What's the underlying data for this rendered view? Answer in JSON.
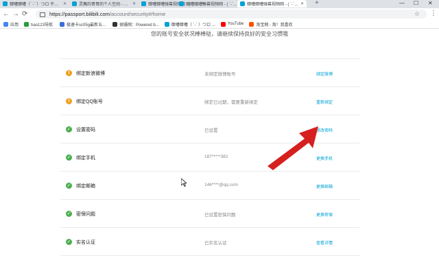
{
  "browser": {
    "tabs": [
      {
        "label": "肆嘈肆嘈（ ´-` ）つロ 干杯~-bili",
        "active": false
      },
      {
        "label": "灵舞的哥哥的个人空间 - 肆嘈肆",
        "active": false
      },
      {
        "label": "肆嘈肆嘈弹幕视频网 - ( ´-` )つロ",
        "active": false
      },
      {
        "label": "肆嘈肆嘈弹幕视频网 - ( ´-` )つロ",
        "active": false
      },
      {
        "label": "肆嘈肆嘈弹幕视频网 - ( ´-` )つロ",
        "active": true
      }
    ],
    "new_tab": "+",
    "window_controls": [
      "—",
      "☐",
      "✕"
    ],
    "url_host": "https://passport.bilibili.com",
    "url_path": "/account/security#/home",
    "bookmarks": [
      {
        "label": "应用",
        "color": "#4285f4"
      },
      {
        "label": "hao123导航",
        "color": "#2a9d3a"
      },
      {
        "label": "极速卡sc05g最新五...",
        "color": "#3a6fd8"
      },
      {
        "label": "很骚网：Powered b...",
        "color": "#333333"
      },
      {
        "label": "肆嘈肆嘈（ ´-` ）つロ ...",
        "color": "#00a1d6"
      },
      {
        "label": "YouTube",
        "color": "#ff0000"
      },
      {
        "label": "淘宝网 - 淘！我喜欢",
        "color": "#ff5000"
      }
    ]
  },
  "page": {
    "heading": "您的账号安全状况棒棒哒，请继续保持良好的安全习惯哦",
    "items": [
      {
        "name": "绑定新浪微博",
        "info": "未绑定微博账号",
        "action": "绑定微博",
        "status": "warn"
      },
      {
        "name": "绑定QQ账号",
        "info": "绑定已过期，需要重新绑定",
        "action": "重新绑定",
        "status": "warn"
      },
      {
        "name": "设置密码",
        "info": "已设置",
        "action": "修改密码",
        "status": "ok"
      },
      {
        "name": "绑定手机",
        "info": "187*****382",
        "action": "更换手机",
        "status": "ok"
      },
      {
        "name": "绑定邮箱",
        "info": "146****@qq.com",
        "action": "更换邮箱",
        "status": "ok"
      },
      {
        "name": "密保问题",
        "info": "已设置密保问题",
        "action": "更换密保",
        "status": "ok"
      },
      {
        "name": "实名认证",
        "info": "已实名认证",
        "action": "查看详情",
        "status": "ok"
      }
    ]
  },
  "colors": {
    "accent": "#00a1d6",
    "ok": "#4caf50",
    "warn": "#f0a020",
    "annotation_arrow": "#d61f1f"
  }
}
